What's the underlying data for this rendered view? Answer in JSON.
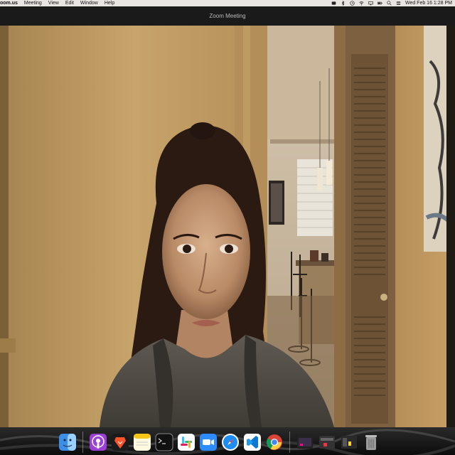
{
  "menubar": {
    "app_name": "oom.us",
    "items": [
      "Meeting",
      "View",
      "Edit",
      "Window",
      "Help"
    ],
    "clock": "Wed Feb 16  1:28 PM",
    "status_icons": [
      "zoom-status-icon",
      "bluetooth-icon",
      "clock-status-icon",
      "wifi-icon",
      "screen-icon",
      "battery-icon",
      "search-icon",
      "control-center-icon"
    ]
  },
  "window": {
    "title": "Zoom Meeting"
  },
  "dock": {
    "apps": [
      "finder-icon",
      "podcasts-icon",
      "brave-browser-icon",
      "notes-icon",
      "terminal-icon",
      "slack-icon",
      "zoom-icon",
      "safari-icon",
      "vscode-icon",
      "chrome-icon"
    ],
    "recent": [
      "recent-window-1",
      "recent-window-2",
      "recent-window-3",
      "trash-icon"
    ]
  },
  "colors": {
    "menubar_bg": "#e9e6e2",
    "titlebar_bg": "#1a1a1a",
    "wall": "#b9955f",
    "dock_bg": "#111111"
  }
}
